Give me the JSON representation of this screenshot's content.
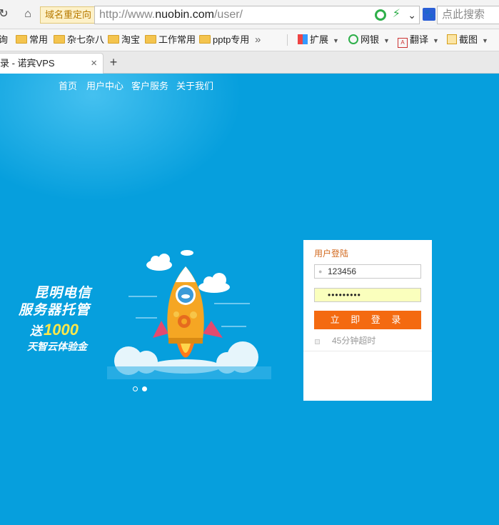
{
  "browser": {
    "redirect_badge": "域名重定向",
    "url_prefix": "http://www.",
    "url_host": "nuobin.com",
    "url_path": "/user/",
    "search_placeholder": "点此搜索",
    "search_engine_icon": "baidu-paw-icon"
  },
  "bookmarks": [
    {
      "label": "询",
      "icon": "folder"
    },
    {
      "label": "常用",
      "icon": "folder"
    },
    {
      "label": "杂七杂八",
      "icon": "folder"
    },
    {
      "label": "淘宝",
      "icon": "folder"
    },
    {
      "label": "工作常用",
      "icon": "folder"
    },
    {
      "label": "pptp专用",
      "icon": "folder"
    },
    {
      "label": "扩展",
      "icon": "extension-grid-icon"
    },
    {
      "label": "网银",
      "icon": "shield-icon"
    },
    {
      "label": "翻译",
      "icon": "translate-icon"
    },
    {
      "label": "截图",
      "icon": "scissors-icon"
    }
  ],
  "tab": {
    "title": "录 - 诺宾VPS",
    "new_tab": "+",
    "close": "×"
  },
  "nav": [
    "首页",
    "用户中心",
    "客户服务",
    "关于我们"
  ],
  "promo": {
    "line1": "昆明电信",
    "line2": "服务器托管",
    "line3_prefix": "送",
    "line3_number": "1000",
    "line4": "天智云体验金"
  },
  "login": {
    "title": "用户登陆",
    "username": "123456",
    "password_mask": "•••••••••",
    "button": "立 即 登 录",
    "timeout_label": "45分钟超时"
  },
  "colors": {
    "page_bg": "#069fdd",
    "login_button": "#f46a10",
    "login_title": "#d2691e",
    "password_autofill": "#faffbd"
  }
}
